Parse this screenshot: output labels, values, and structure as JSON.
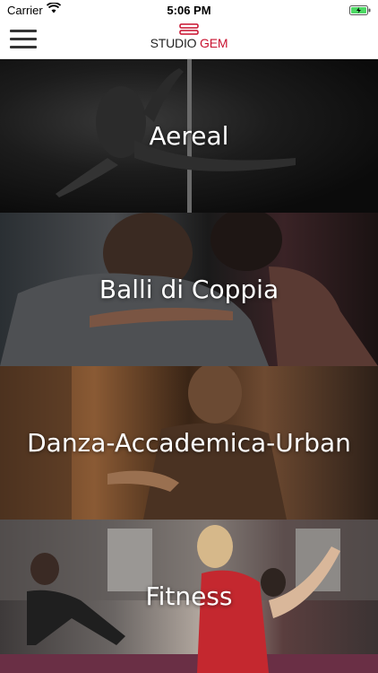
{
  "status_bar": {
    "carrier": "Carrier",
    "time": "5:06 PM"
  },
  "header": {
    "logo_studio": "STUDIO ",
    "logo_gem": "GEM",
    "brand_color": "#c8102e"
  },
  "categories": [
    {
      "label": "Aereal"
    },
    {
      "label": "Balli di Coppia"
    },
    {
      "label": "Danza-Accademica-Urban"
    },
    {
      "label": "Fitness"
    }
  ]
}
